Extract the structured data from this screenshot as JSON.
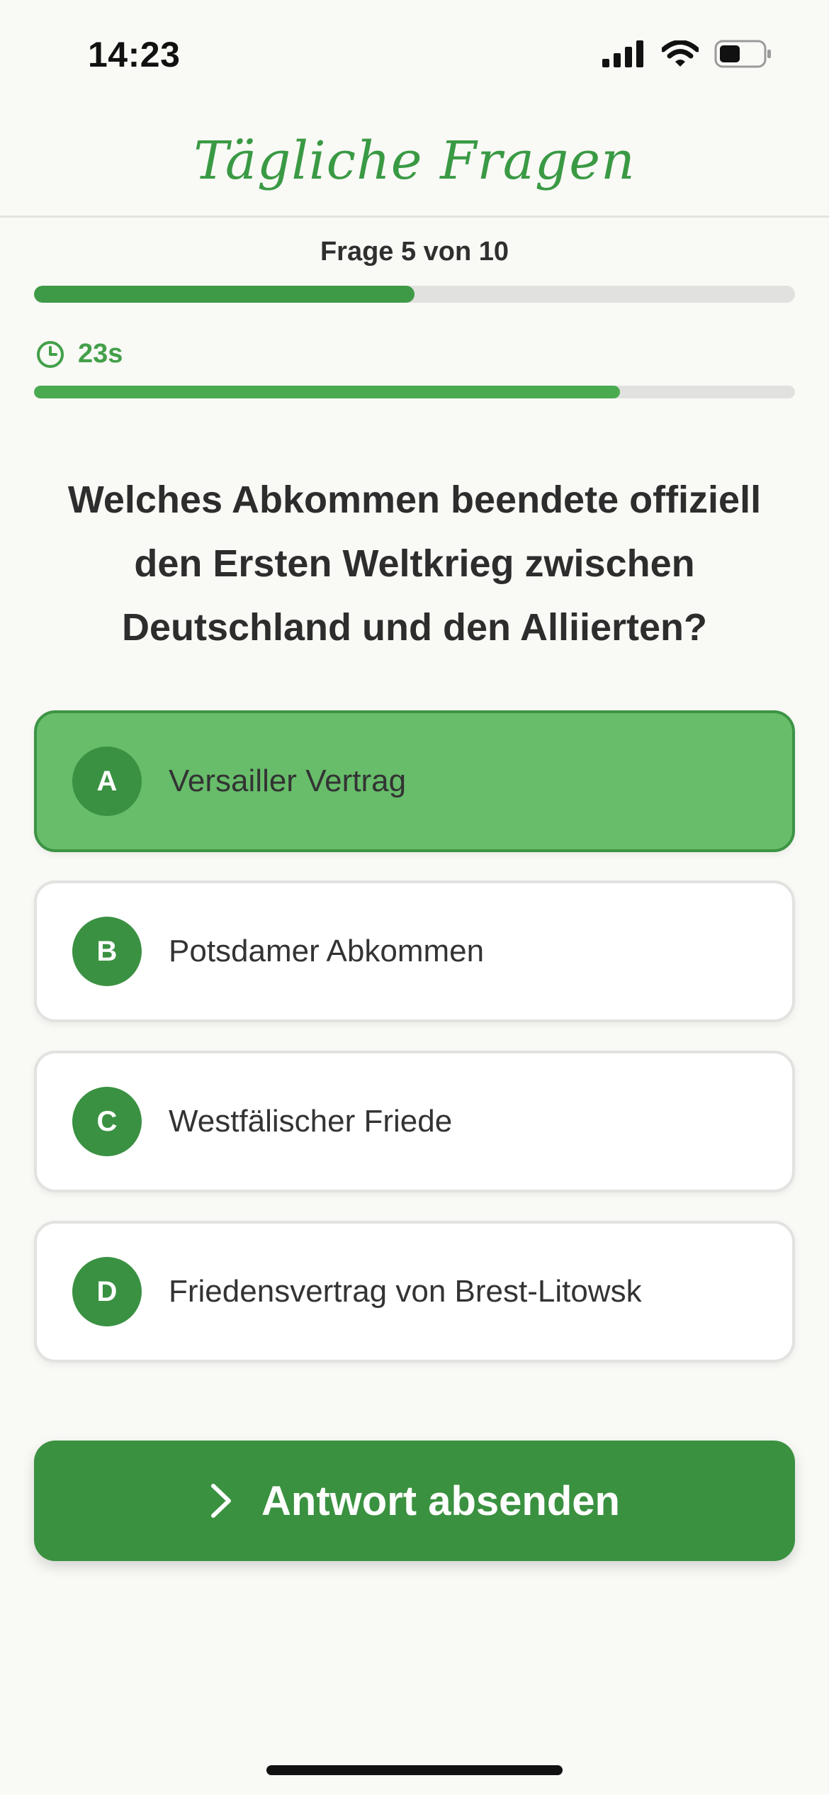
{
  "status_bar": {
    "time": "14:23",
    "icons": [
      "cellular-signal-icon",
      "wifi-icon",
      "battery-icon"
    ]
  },
  "header": {
    "title": "Tägliche Fragen"
  },
  "progress": {
    "label": "Frage 5 von 10",
    "current": 5,
    "total": 10,
    "fraction": 0.5
  },
  "timer": {
    "icon": "clock-icon",
    "label": "23s",
    "fraction_remaining": 0.77
  },
  "question": {
    "text": "Welches Abkommen beendete offiziell den Ersten Weltkrieg zwischen Deutschland und den Alliierten?"
  },
  "answers": [
    {
      "letter": "A",
      "label": "Versailler Vertrag",
      "selected": true
    },
    {
      "letter": "B",
      "label": "Potsdamer Abkommen",
      "selected": false
    },
    {
      "letter": "C",
      "label": "Westfälischer Friede",
      "selected": false
    },
    {
      "letter": "D",
      "label": "Friedensvertrag von Brest-Litowsk",
      "selected": false
    }
  ],
  "submit": {
    "label": "Antwort absenden",
    "icon": "chevron-right-icon"
  },
  "colors": {
    "primary": "#3a9140",
    "selected_answer": "#67bd6a",
    "title": "#3a9a44"
  }
}
